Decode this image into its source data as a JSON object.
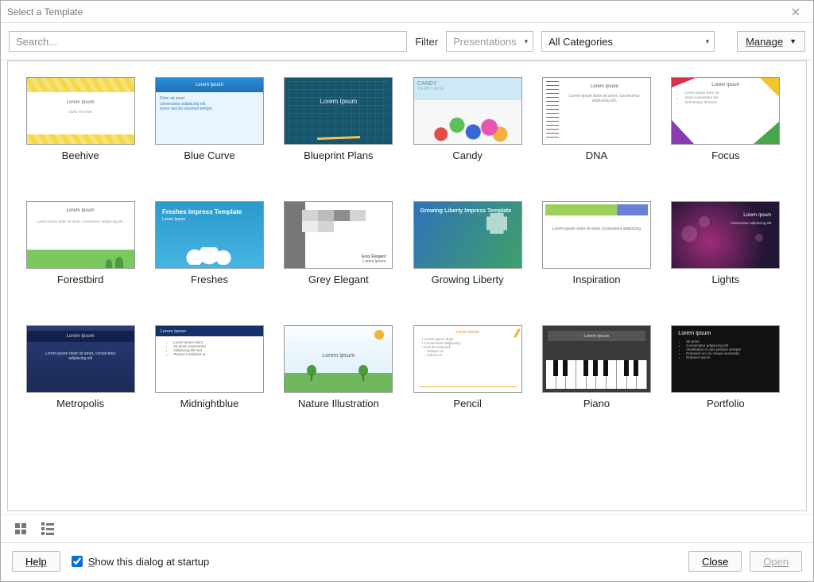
{
  "window": {
    "title": "Select a Template"
  },
  "toolbar": {
    "search_placeholder": "Search...",
    "filter_label": "Filter",
    "app_filter": "Presentations",
    "category_filter": "All Categories",
    "manage_label": "Manage"
  },
  "templates": [
    {
      "name": "Beehive"
    },
    {
      "name": "Blue Curve"
    },
    {
      "name": "Blueprint Plans"
    },
    {
      "name": "Candy"
    },
    {
      "name": "DNA"
    },
    {
      "name": "Focus"
    },
    {
      "name": "Forestbird"
    },
    {
      "name": "Freshes"
    },
    {
      "name": "Grey Elegant"
    },
    {
      "name": "Growing Liberty"
    },
    {
      "name": "Inspiration"
    },
    {
      "name": "Lights"
    },
    {
      "name": "Metropolis"
    },
    {
      "name": "Midnightblue"
    },
    {
      "name": "Nature Illustration"
    },
    {
      "name": "Pencil"
    },
    {
      "name": "Piano"
    },
    {
      "name": "Portfolio"
    }
  ],
  "thumb_text": {
    "lorem_title": "Lorem Ipsum",
    "lorem_sub": "Dolor Sit Amet",
    "candy_title": "CANDY",
    "candy_sub": "TEMPLATE",
    "dna_body": "Lorem ipsum dolor sit amet, consectetur adipiscing elit.",
    "freshes_title": "Freshes Impress Template",
    "greyel_sig": "Grey Elegant",
    "liberty_title": "Growing Liberty Impress Template",
    "insp_body": "Lorem ipsum dolor sit amet consectetur adipiscing",
    "lights_sub": "consectetur adipiscing elit",
    "metro_sub": "Lorem ipsum dolor sit amet, consectetur adipiscing elit"
  },
  "footer": {
    "help_label": "Help",
    "show_startup_label": "Show this dialog at startup",
    "show_startup_checked": true,
    "close_label": "Close",
    "open_label": "Open"
  }
}
